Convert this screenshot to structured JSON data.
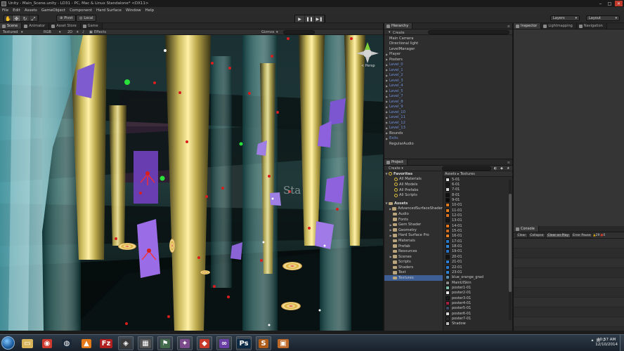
{
  "window": {
    "title": "Unity - Main_Scene.unity - LD31 - PC, Mac & Linux Standalone* <DX11>",
    "minimize": "‒",
    "maximize": "□",
    "close": "✕"
  },
  "menu": [
    "File",
    "Edit",
    "Assets",
    "GameObject",
    "Component",
    "Hard Surface",
    "Window",
    "Help"
  ],
  "toolbar": {
    "transform_tools": [
      "hand-icon",
      "move-icon",
      "rotate-icon",
      "scale-icon"
    ],
    "pivot": "Pivot",
    "local": "Local",
    "play": "▶",
    "pause": "❚❚",
    "step": "▶❚",
    "layers": "Layers",
    "layout": "Layout"
  },
  "tabs": {
    "scene": "Scene",
    "animator": "Animator",
    "asset_store": "Asset Store",
    "game": "Game",
    "hierarchy": "Hierarchy",
    "inspector": "Inspector",
    "lightmapping": "Lightmapping",
    "navigation": "Navigation",
    "project": "Project",
    "console": "Console"
  },
  "scene_controls": {
    "draw_mode": "Textured",
    "render_mode": "RGB",
    "mode_2d": "2D",
    "effects": "Effects",
    "gizmos": "Gizmos",
    "persp": "< Persp",
    "stage_text": "Sta"
  },
  "hierarchy": {
    "create": "Create",
    "items": [
      {
        "label": "Main Camera",
        "prefab": false,
        "expand": false
      },
      {
        "label": "Directional light",
        "prefab": false,
        "expand": false
      },
      {
        "label": "LevelManager",
        "prefab": false,
        "expand": false
      },
      {
        "label": "Player",
        "prefab": false,
        "expand": true
      },
      {
        "label": "Posters",
        "prefab": false,
        "expand": true
      },
      {
        "label": "Level_0",
        "prefab": true,
        "expand": true
      },
      {
        "label": "Level_1",
        "prefab": true,
        "expand": true
      },
      {
        "label": "Level_2",
        "prefab": true,
        "expand": true
      },
      {
        "label": "Level_3",
        "prefab": true,
        "expand": true
      },
      {
        "label": "Level_4",
        "prefab": true,
        "expand": true
      },
      {
        "label": "Level_5",
        "prefab": true,
        "expand": true
      },
      {
        "label": "Level_7",
        "prefab": true,
        "expand": true
      },
      {
        "label": "Level_8",
        "prefab": true,
        "expand": true
      },
      {
        "label": "Level_9",
        "prefab": true,
        "expand": true
      },
      {
        "label": "Level_10",
        "prefab": true,
        "expand": true
      },
      {
        "label": "Level_11",
        "prefab": true,
        "expand": true
      },
      {
        "label": "Level_12",
        "prefab": true,
        "expand": true
      },
      {
        "label": "Level_13",
        "prefab": true,
        "expand": true
      },
      {
        "label": "Bounds",
        "prefab": false,
        "expand": true
      },
      {
        "label": "Exits",
        "prefab": true,
        "expand": true
      },
      {
        "label": "RegularAudio",
        "prefab": false,
        "expand": false
      }
    ]
  },
  "project": {
    "create": "Create",
    "favorites_label": "Favorites",
    "favorites": [
      "All Materials",
      "All Models",
      "All Prefabs",
      "All Scripts"
    ],
    "assets_label": "Assets",
    "folders": [
      {
        "label": "AdvancedSurfaceShader",
        "expand": true
      },
      {
        "label": "Audio",
        "expand": false
      },
      {
        "label": "Fonts",
        "expand": false
      },
      {
        "label": "Gem Shader",
        "expand": true
      },
      {
        "label": "Geometry",
        "expand": true
      },
      {
        "label": "Hard Surface Pro",
        "expand": true
      },
      {
        "label": "Materials",
        "expand": false
      },
      {
        "label": "Prefab",
        "expand": false
      },
      {
        "label": "Resources",
        "expand": false
      },
      {
        "label": "Scenes",
        "expand": true
      },
      {
        "label": "Scripts",
        "expand": false
      },
      {
        "label": "Shaders",
        "expand": false
      },
      {
        "label": "Text",
        "expand": false
      },
      {
        "label": "Textures",
        "expand": false,
        "selected": true
      }
    ],
    "breadcrumb": "Assets ▸ Textures",
    "textures": [
      {
        "label": "5-01",
        "color": "#dcdcdc"
      },
      {
        "label": "6-01",
        "color": "#1a1a1a"
      },
      {
        "label": "7-01",
        "color": "#d8d8d8"
      },
      {
        "label": "8-01",
        "color": "#101010"
      },
      {
        "label": "9-01",
        "color": "#0a0a0a"
      },
      {
        "label": "10-01",
        "color": "#e07a22"
      },
      {
        "label": "11-01",
        "color": "#e57e1e"
      },
      {
        "label": "12-01",
        "color": "#d97323"
      },
      {
        "label": "13-01",
        "color": "#161616"
      },
      {
        "label": "14-01",
        "color": "#e3761c"
      },
      {
        "label": "15-01",
        "color": "#cf6d20"
      },
      {
        "label": "16-01",
        "color": "#e48127"
      },
      {
        "label": "17-01",
        "color": "#2b7ac9"
      },
      {
        "label": "18-01",
        "color": "#3286d6"
      },
      {
        "label": "19-01",
        "color": "#2a73c4"
      },
      {
        "label": "20-01",
        "color": "#111111"
      },
      {
        "label": "21-01",
        "color": "#2f7dd1"
      },
      {
        "label": "22-01",
        "color": "#2c78cb"
      },
      {
        "label": "23-01",
        "color": "#2e83d4"
      },
      {
        "label": "blue_orange_grad",
        "color": "#5a8fb0"
      },
      {
        "label": "MainUISkin",
        "color": "#888888"
      },
      {
        "label": "poster1-01",
        "color": "#7fc0a8"
      },
      {
        "label": "poster2-01",
        "color": "#e8e8e8"
      },
      {
        "label": "poster3-01",
        "color": "#1b1b1b"
      },
      {
        "label": "poster4-01",
        "color": "#a31f3f"
      },
      {
        "label": "poster5-01",
        "color": "#3a4a66"
      },
      {
        "label": "poster6-01",
        "color": "#d9d9d9"
      },
      {
        "label": "poster7-01",
        "color": "#2b2b2b"
      },
      {
        "label": "Shadow",
        "color": "#bdbdbd"
      }
    ]
  },
  "console": {
    "buttons": [
      "Clear",
      "Collapse",
      "Clear on Play",
      "Error Pause"
    ],
    "warnings": "29",
    "errors": "0"
  },
  "taskbar": {
    "apps": [
      {
        "name": "explorer-icon",
        "glyph": "▭",
        "color": "#d8b45a"
      },
      {
        "name": "chrome-icon",
        "glyph": "◉",
        "color": "#cf3b2e"
      },
      {
        "name": "steam-icon",
        "glyph": "◍",
        "color": "#1b2838"
      },
      {
        "name": "vlc-icon",
        "glyph": "▲",
        "color": "#e57a1a"
      },
      {
        "name": "filezilla-icon",
        "glyph": "Fz",
        "color": "#b01f1f"
      },
      {
        "name": "unity-icon",
        "glyph": "◈",
        "color": "#3a3a3a"
      },
      {
        "name": "app-icon",
        "glyph": "▦",
        "color": "#555555"
      },
      {
        "name": "app2-icon",
        "glyph": "⚑",
        "color": "#446a4c"
      },
      {
        "name": "app3-icon",
        "glyph": "✦",
        "color": "#7c4b8c"
      },
      {
        "name": "git-icon",
        "glyph": "◆",
        "color": "#c73a2a"
      },
      {
        "name": "visual-studio-icon",
        "glyph": "∞",
        "color": "#6a3fa6"
      },
      {
        "name": "photoshop-icon",
        "glyph": "Ps",
        "color": "#0d2a44"
      },
      {
        "name": "sublime-icon",
        "glyph": "S",
        "color": "#ad5c1a"
      },
      {
        "name": "app4-icon",
        "glyph": "▣",
        "color": "#bd6a2a"
      }
    ],
    "time": "10:57 AM",
    "date": "12/10/2014"
  }
}
